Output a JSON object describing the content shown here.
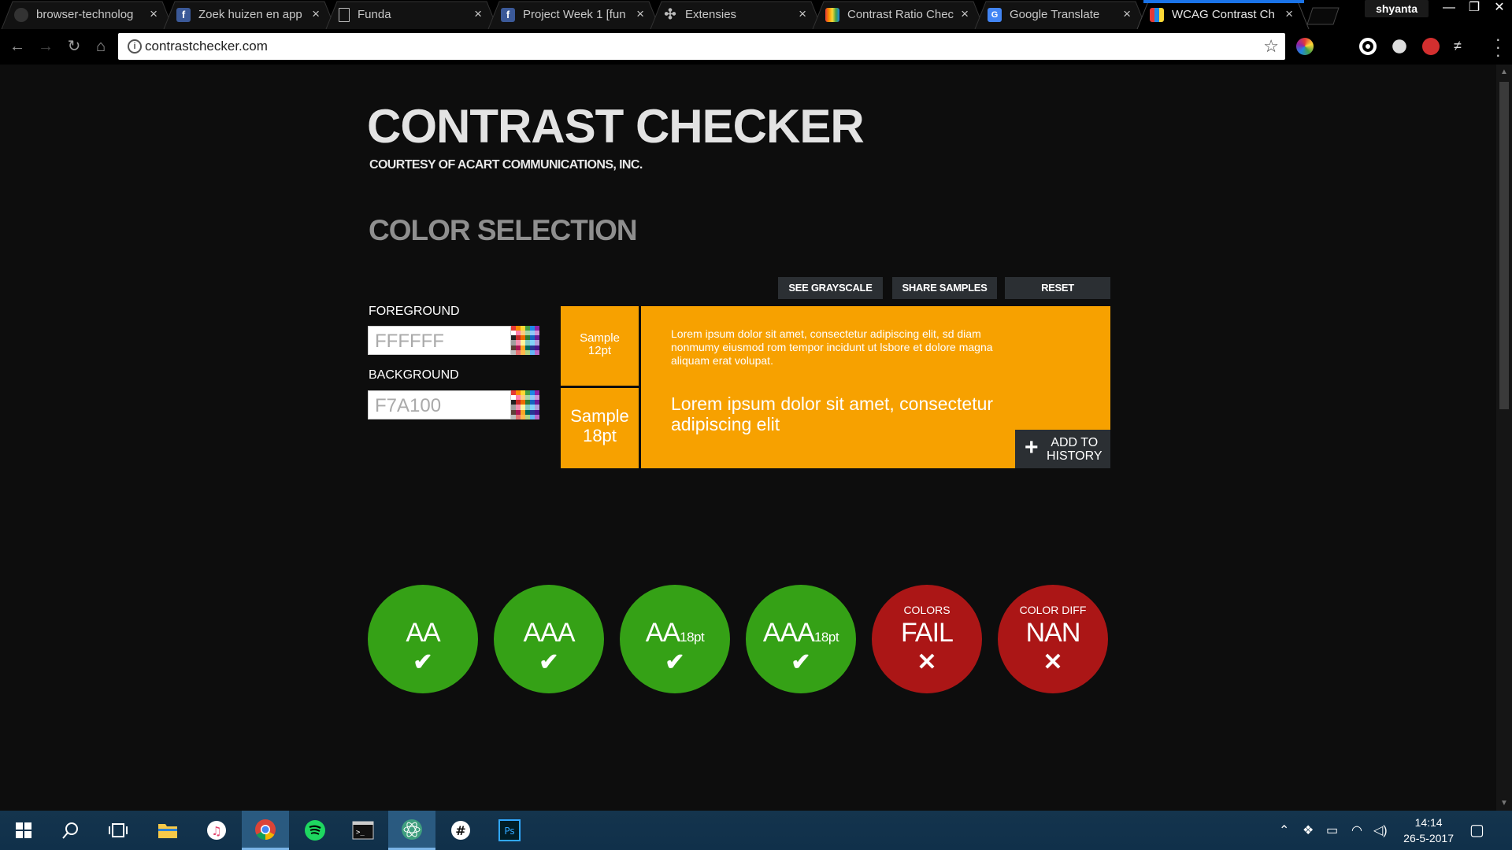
{
  "browser": {
    "tabs": [
      {
        "title": "browser-technolog",
        "icon": "github-icon"
      },
      {
        "title": "Zoek huizen en app",
        "icon": "facebook-icon"
      },
      {
        "title": "Funda",
        "icon": "document-icon"
      },
      {
        "title": "Project Week 1 [fun",
        "icon": "facebook-icon"
      },
      {
        "title": "Extensies",
        "icon": "puzzle-icon"
      },
      {
        "title": "Contrast Ratio Chec",
        "icon": "rainbow-icon"
      },
      {
        "title": "Google Translate",
        "icon": "translate-icon"
      },
      {
        "title": "WCAG Contrast Ch",
        "icon": "grid-icon",
        "active": true
      }
    ],
    "profile": "shyanta",
    "url": "contrastchecker.com"
  },
  "page": {
    "title": "CONTRAST CHECKER",
    "courtesy": "COURTESY OF ACART COMMUNICATIONS, INC.",
    "section_title": "COLOR SELECTION",
    "buttons": {
      "grayscale": "SEE GRAYSCALE",
      "share": "SHARE SAMPLES",
      "reset": "RESET"
    },
    "foreground": {
      "label": "FOREGROUND",
      "value": "FFFFFF"
    },
    "background": {
      "label": "BACKGROUND",
      "value": "F7A100"
    },
    "sample": {
      "small_label_1": "Sample",
      "small_label_2": "12pt",
      "large_label_1": "Sample",
      "large_label_2": "18pt",
      "small_text": "Lorem ipsum dolor sit amet, consectetur adipiscing elit, sd diam nonmumy eiusmod rom tempor incidunt ut lsbore et dolore magna aliquam erat volupat.",
      "large_text": "Lorem ipsum dolor sit amet, consectetur adipiscing elit",
      "add_history_1": "ADD TO",
      "add_history_2": "HISTORY"
    },
    "results": [
      {
        "label": "AA",
        "sub": "",
        "caption": "",
        "status": "pass",
        "mark": "✔"
      },
      {
        "label": "AAA",
        "sub": "",
        "caption": "",
        "status": "pass",
        "mark": "✔"
      },
      {
        "label": "AA",
        "sub": "18pt",
        "caption": "",
        "status": "pass",
        "mark": "✔"
      },
      {
        "label": "AAA",
        "sub": "18pt",
        "caption": "",
        "status": "pass",
        "mark": "✔"
      },
      {
        "label": "FAIL",
        "sub": "",
        "caption": "COLORS",
        "status": "fail",
        "mark": "✕"
      },
      {
        "label": "NAN",
        "sub": "",
        "caption": "COLOR DIFF",
        "status": "fail",
        "mark": "✕"
      }
    ],
    "colors": {
      "sample_bg": "#f7a100",
      "pass": "#35a116",
      "fail": "#ab1616"
    }
  },
  "taskbar": {
    "clock_time": "14:14",
    "clock_date": "26-5-2017"
  }
}
